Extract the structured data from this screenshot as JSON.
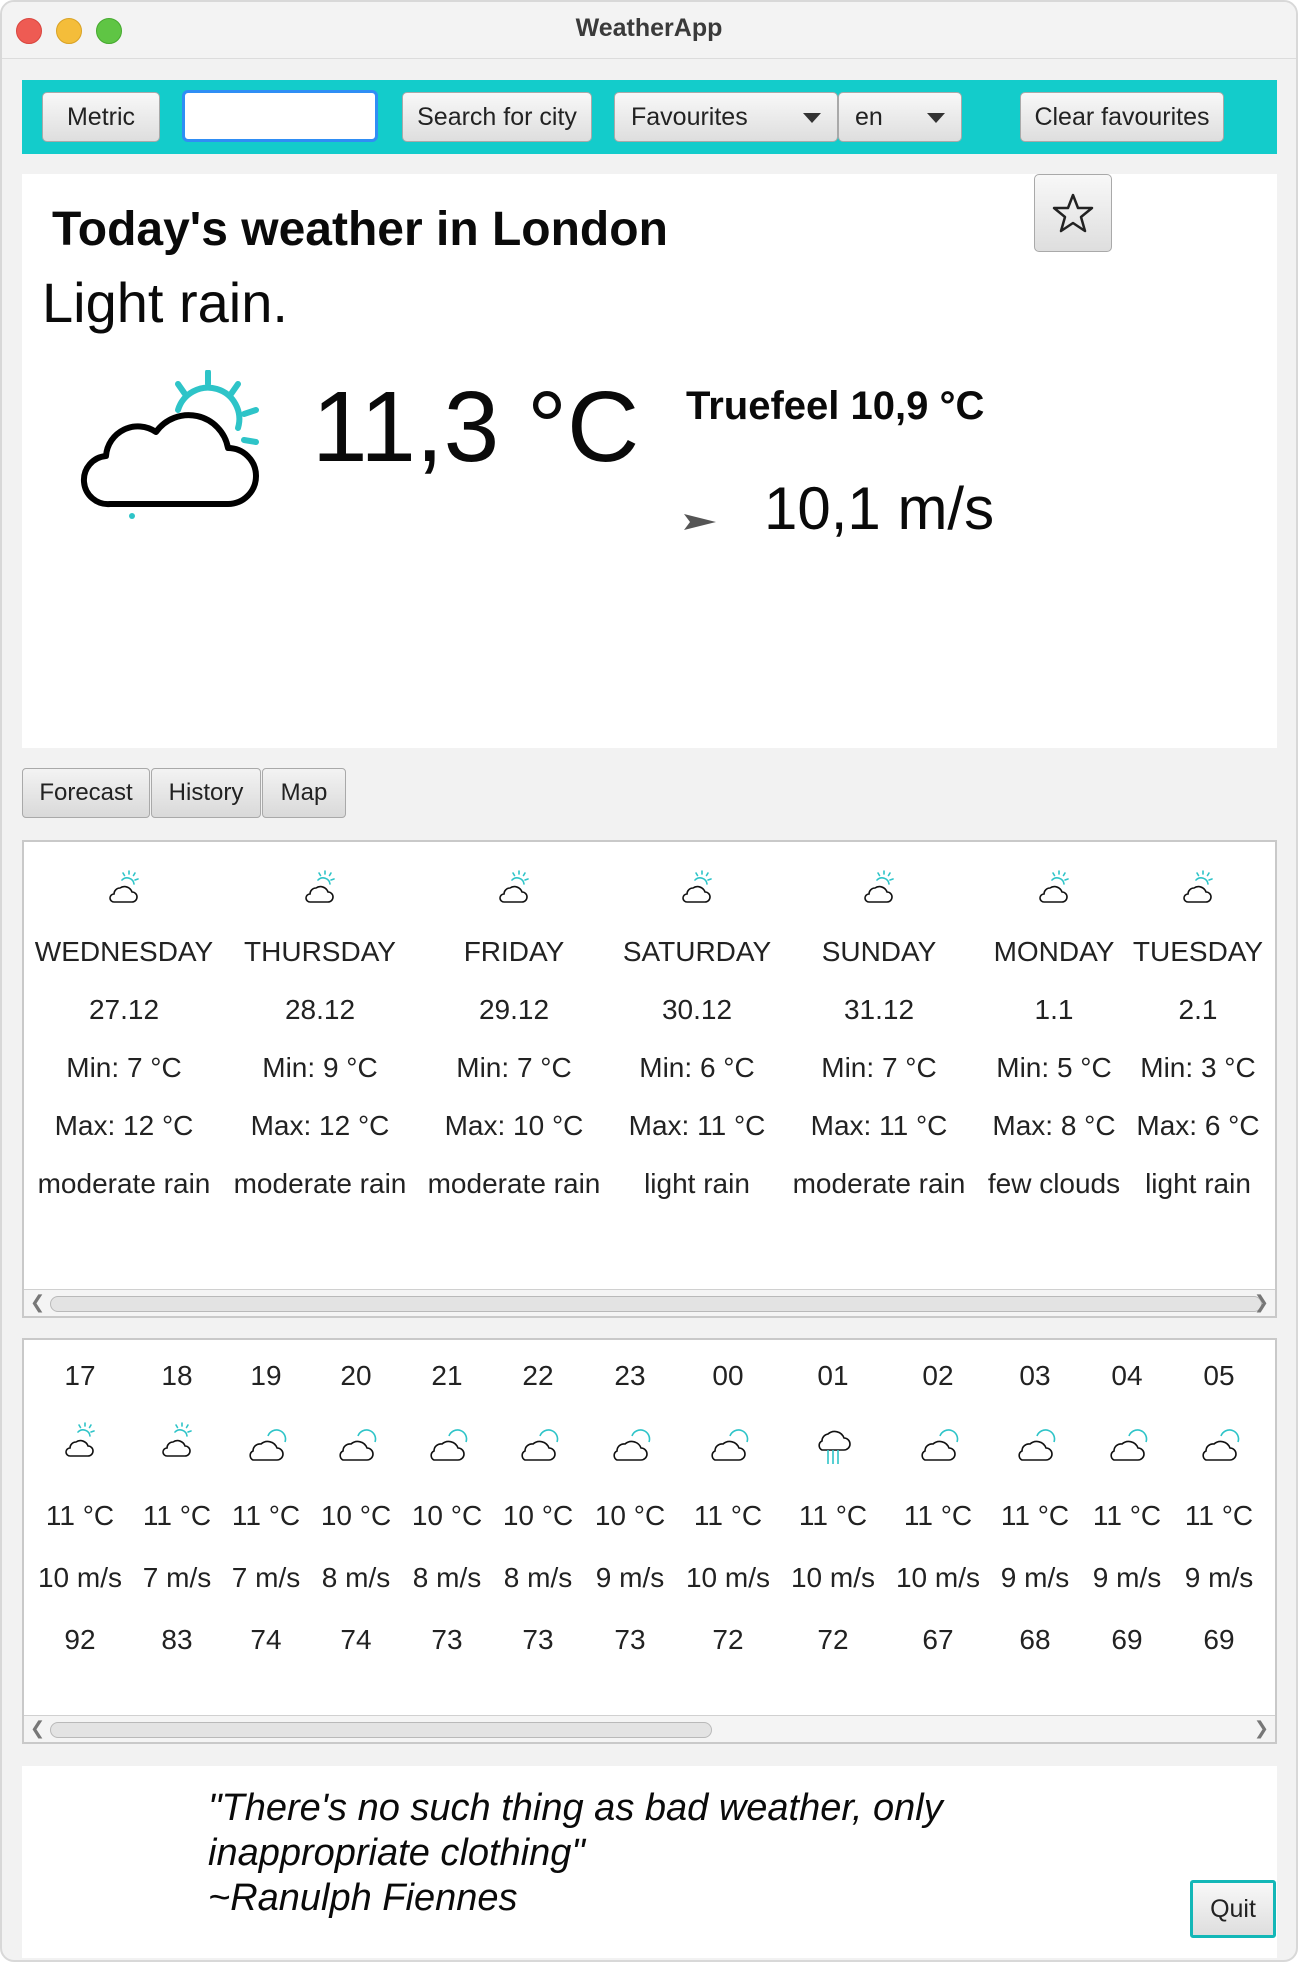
{
  "window": {
    "title": "WeatherApp"
  },
  "toolbar": {
    "units_label": "Metric",
    "search_value": "",
    "search_label": "Search for city",
    "favourites_label": "Favourites",
    "language_value": "en",
    "clear_label": "Clear favourites"
  },
  "current": {
    "headline": "Today's weather in London",
    "description": "Light rain.",
    "temperature": "11,3 °C",
    "truefeel": "Truefeel 10,9 °C",
    "wind": "10,1 m/s",
    "icon": "cloud-sun-rain-icon"
  },
  "tabs": [
    {
      "label": "Forecast"
    },
    {
      "label": "History"
    },
    {
      "label": "Map"
    }
  ],
  "daily": [
    {
      "day": "WEDNESDAY",
      "date": "27.12",
      "min": "Min: 7 °C",
      "max": "Max: 12 °C",
      "desc": "moderate rain",
      "icon": "cloud-sun-icon"
    },
    {
      "day": "THURSDAY",
      "date": "28.12",
      "min": "Min: 9 °C",
      "max": "Max: 12 °C",
      "desc": "moderate rain",
      "icon": "cloud-sun-icon"
    },
    {
      "day": "FRIDAY",
      "date": "29.12",
      "min": "Min: 7 °C",
      "max": "Max: 10 °C",
      "desc": "moderate rain",
      "icon": "cloud-sun-icon"
    },
    {
      "day": "SATURDAY",
      "date": "30.12",
      "min": "Min: 6 °C",
      "max": "Max: 11 °C",
      "desc": "light rain",
      "icon": "cloud-sun-icon"
    },
    {
      "day": "SUNDAY",
      "date": "31.12",
      "min": "Min: 7 °C",
      "max": "Max: 11 °C",
      "desc": "moderate rain",
      "icon": "cloud-sun-icon"
    },
    {
      "day": "MONDAY",
      "date": "1.1",
      "min": "Min: 5 °C",
      "max": "Max: 8 °C",
      "desc": "few clouds",
      "icon": "cloud-sun-icon"
    },
    {
      "day": "TUESDAY",
      "date": "2.1",
      "min": "Min: 3 °C",
      "max": "Max: 6 °C",
      "desc": "light rain",
      "icon": "cloud-sun-icon"
    }
  ],
  "hourly": [
    {
      "hour": "17",
      "temp": "11 °C",
      "wind": "10 m/s",
      "humidity": "92",
      "icon": "cloud-sun-icon"
    },
    {
      "hour": "18",
      "temp": "11 °C",
      "wind": "7 m/s",
      "humidity": "83",
      "icon": "cloud-sun-icon"
    },
    {
      "hour": "19",
      "temp": "11 °C",
      "wind": "7 m/s",
      "humidity": "74",
      "icon": "cloud-sun-icon"
    },
    {
      "hour": "20",
      "temp": "10 °C",
      "wind": "8 m/s",
      "humidity": "74",
      "icon": "cloud-sun-icon"
    },
    {
      "hour": "21",
      "temp": "10 °C",
      "wind": "8 m/s",
      "humidity": "73",
      "icon": "cloud-sun-icon"
    },
    {
      "hour": "22",
      "temp": "10 °C",
      "wind": "8 m/s",
      "humidity": "73",
      "icon": "cloud-sun-icon"
    },
    {
      "hour": "23",
      "temp": "10 °C",
      "wind": "9 m/s",
      "humidity": "73",
      "icon": "cloud-sun-icon"
    },
    {
      "hour": "00",
      "temp": "11 °C",
      "wind": "10 m/s",
      "humidity": "72",
      "icon": "cloud-sun-icon"
    },
    {
      "hour": "01",
      "temp": "11 °C",
      "wind": "10 m/s",
      "humidity": "72",
      "icon": "cloud-rain-icon"
    },
    {
      "hour": "02",
      "temp": "11 °C",
      "wind": "10 m/s",
      "humidity": "67",
      "icon": "cloud-sun-icon"
    },
    {
      "hour": "03",
      "temp": "11 °C",
      "wind": "9 m/s",
      "humidity": "68",
      "icon": "cloud-sun-icon"
    },
    {
      "hour": "04",
      "temp": "11 °C",
      "wind": "9 m/s",
      "humidity": "69",
      "icon": "cloud-sun-icon"
    },
    {
      "hour": "05",
      "temp": "11 °C",
      "wind": "9 m/s",
      "humidity": "69",
      "icon": "cloud-sun-icon"
    }
  ],
  "quote": {
    "line1": "\"There's no such thing as bad weather, only",
    "line2": "inappropriate clothing\"",
    "author": "~Ranulph Fiennes"
  },
  "quit_label": "Quit",
  "colors": {
    "accent": "#13cccb",
    "icon_sun": "#2ec4c8",
    "focus": "#2f8ef5"
  }
}
